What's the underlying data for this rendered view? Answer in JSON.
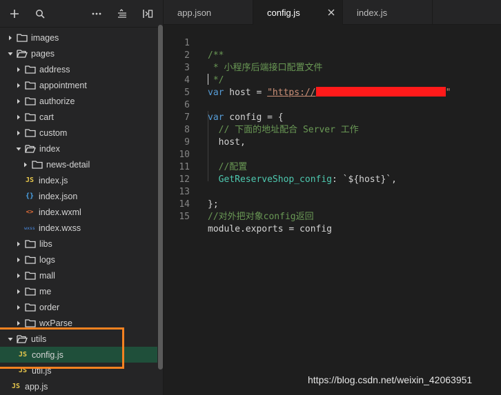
{
  "sidebar": {
    "toolbar": {
      "icons": [
        "plus-icon",
        "search-icon",
        "more-icon",
        "collapse-all-icon",
        "split-layout-icon"
      ]
    },
    "tree": [
      {
        "label": "images",
        "type": "folder",
        "expanded": false
      },
      {
        "label": "pages",
        "type": "folder",
        "expanded": true
      },
      {
        "label": "address",
        "type": "folder",
        "expanded": false
      },
      {
        "label": "appointment",
        "type": "folder",
        "expanded": false
      },
      {
        "label": "authorize",
        "type": "folder",
        "expanded": false
      },
      {
        "label": "cart",
        "type": "folder",
        "expanded": false
      },
      {
        "label": "custom",
        "type": "folder",
        "expanded": false
      },
      {
        "label": "index",
        "type": "folder",
        "expanded": true
      },
      {
        "label": "news-detail",
        "type": "folder",
        "expanded": false
      },
      {
        "label": "index.js",
        "type": "js",
        "icon_text": "JS"
      },
      {
        "label": "index.json",
        "type": "json",
        "icon_text": "{}"
      },
      {
        "label": "index.wxml",
        "type": "wxml",
        "icon_text": "<>"
      },
      {
        "label": "index.wxss",
        "type": "wxss",
        "icon_text": "wxss"
      },
      {
        "label": "libs",
        "type": "folder",
        "expanded": false
      },
      {
        "label": "logs",
        "type": "folder",
        "expanded": false
      },
      {
        "label": "mall",
        "type": "folder",
        "expanded": false
      },
      {
        "label": "me",
        "type": "folder",
        "expanded": false
      },
      {
        "label": "order",
        "type": "folder",
        "expanded": false
      },
      {
        "label": "wxParse",
        "type": "folder",
        "expanded": false
      },
      {
        "label": "utils",
        "type": "folder",
        "expanded": true
      },
      {
        "label": "config.js",
        "type": "js",
        "icon_text": "JS",
        "selected": true
      },
      {
        "label": "util.js",
        "type": "js",
        "icon_text": "JS"
      },
      {
        "label": "app.js",
        "type": "js",
        "icon_text": "JS"
      }
    ]
  },
  "tabs": [
    {
      "label": "app.json",
      "active": false
    },
    {
      "label": "config.js",
      "active": true
    },
    {
      "label": "index.js",
      "active": false
    }
  ],
  "editor": {
    "line_numbers": [
      "1",
      "2",
      "3",
      "4",
      "5",
      "6",
      "7",
      "8",
      "9",
      "10",
      "11",
      "12",
      "13",
      "14",
      "15"
    ],
    "lines": {
      "l1": "/**",
      "l2": " * 小程序后端接口配置文件",
      "l3": " */",
      "l4_kw": "var",
      "l4_rest": " host = ",
      "l4_str": "\"https://",
      "l4_end": "\"",
      "l6_kw": "var",
      "l6_rest": " config = {",
      "l7": "  // 下面的地址配合 Server 工作",
      "l8": "  host,",
      "l10": "  //配置",
      "l11_fn": "  GetReserveShop_config",
      "l11_rest": ": `${host}`,",
      "l13": "};",
      "l14": "//对外把对象config返回",
      "l15": "module.exports = config"
    }
  },
  "watermark": "https://blog.csdn.net/weixin_42063951",
  "colors": {
    "highlight_box": "#f58220",
    "redaction": "#ff1a1a",
    "selected_row": "#1f4f3a"
  }
}
